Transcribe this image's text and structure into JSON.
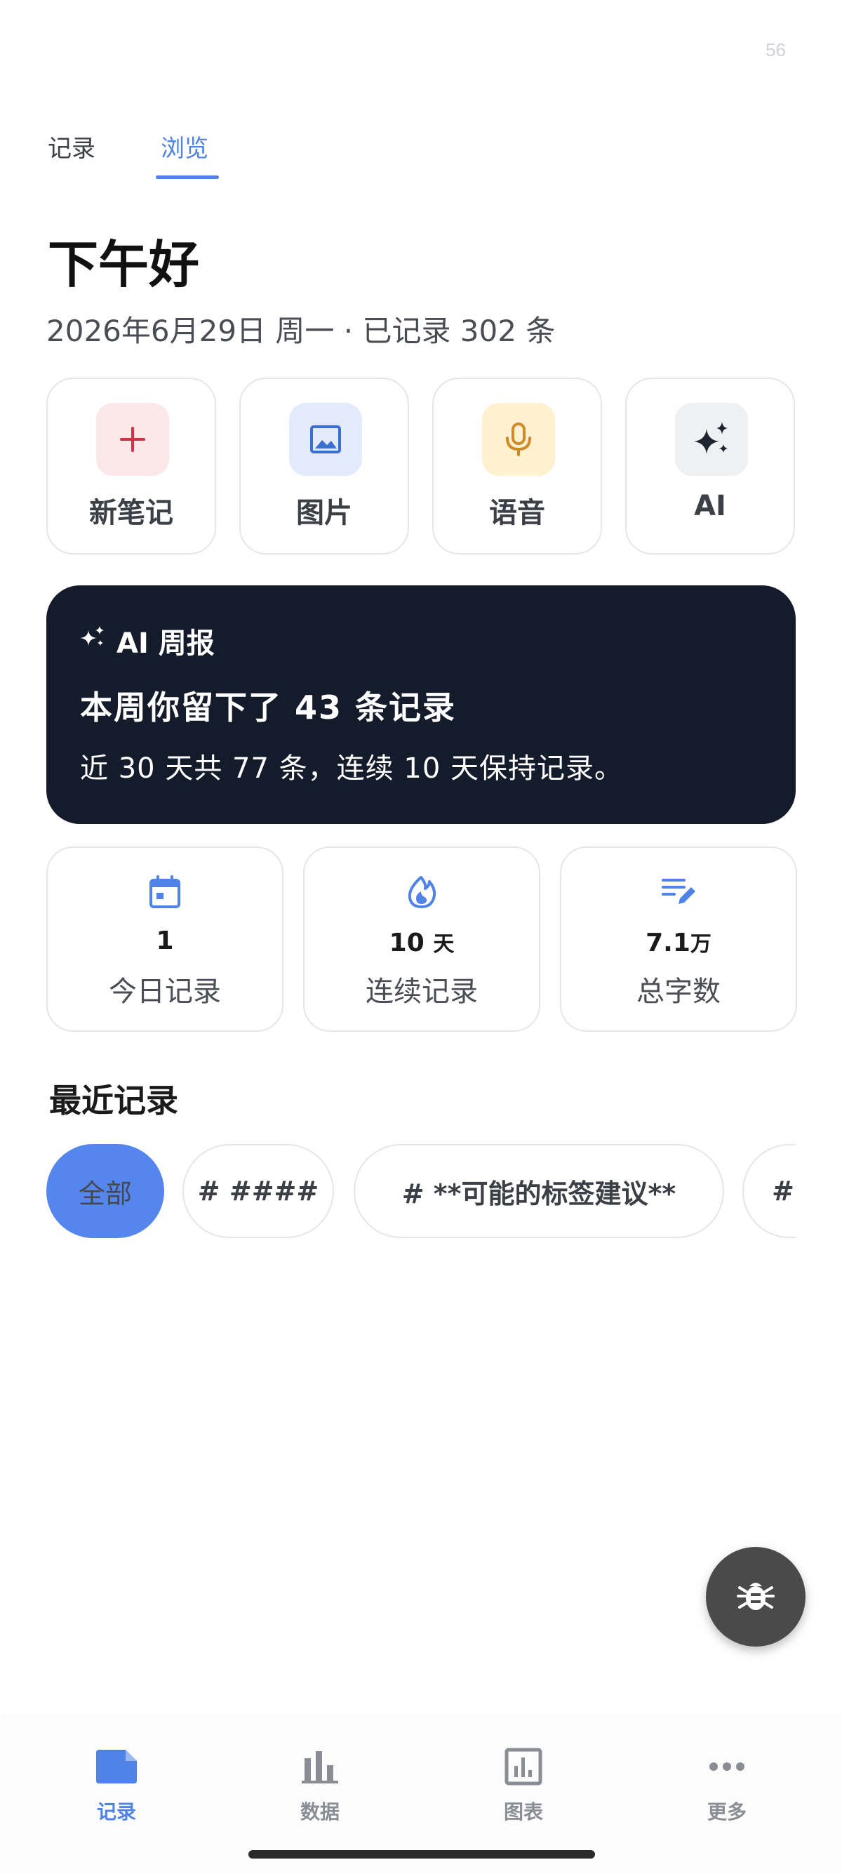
{
  "status": {
    "number": "56"
  },
  "top_tabs": [
    {
      "label": "记录",
      "active": false
    },
    {
      "label": "浏览",
      "active": true
    }
  ],
  "greeting": "下午好",
  "subtitle": "2026年6月29日 周一 · 已记录 302 条",
  "quick_actions": [
    {
      "label": "新笔记",
      "icon": "plus-icon",
      "color": "#c9354b",
      "bg": "#fbe6e8"
    },
    {
      "label": "图片",
      "icon": "image-icon",
      "color": "#3d6fd1",
      "bg": "#e3ebfb"
    },
    {
      "label": "语音",
      "icon": "microphone-icon",
      "color": "#d08a2a",
      "bg": "#fdf1cf"
    },
    {
      "label": "AI",
      "icon": "sparkles-icon",
      "color": "#1e2430",
      "bg": "#eff0f2"
    }
  ],
  "ai_report": {
    "heading": "AI 周报",
    "title": "本周你留下了 43 条记录",
    "description": "近 30 天共 77 条，连续 10 天保持记录。",
    "background": "#141b2a"
  },
  "stats": [
    {
      "value": "1",
      "unit": "",
      "label": "今日记录",
      "icon": "calendar-icon"
    },
    {
      "value": "10",
      "unit": "天",
      "label": "连续记录",
      "icon": "flame-icon"
    },
    {
      "value": "7.1",
      "unit": "万",
      "label": "总字数",
      "icon": "edit-note-icon"
    }
  ],
  "recent": {
    "title": "最近记录",
    "chips": [
      {
        "label": "全部",
        "active": true
      },
      {
        "label": "# ####",
        "active": false
      },
      {
        "label": "# **可能的标签建议**",
        "active": false
      },
      {
        "label": "#",
        "active": false
      }
    ]
  },
  "fab": {
    "icon": "bug-icon"
  },
  "bottom_nav": [
    {
      "label": "记录",
      "icon": "note-icon",
      "active": true
    },
    {
      "label": "数据",
      "icon": "bar-chart-icon",
      "active": false
    },
    {
      "label": "图表",
      "icon": "chart-box-icon",
      "active": false
    },
    {
      "label": "更多",
      "icon": "more-icon",
      "active": false
    }
  ],
  "colors": {
    "accent": "#4f83e6",
    "chip_active": "#5586ee",
    "dark_card": "#141b2a"
  }
}
